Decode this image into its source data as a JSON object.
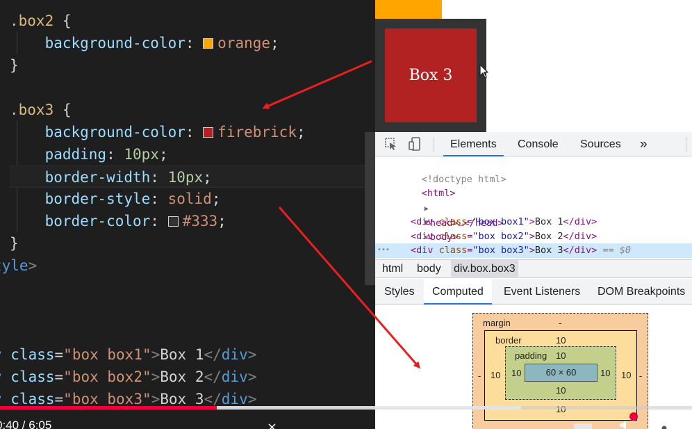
{
  "editor": {
    "lines": [
      {
        "tokens": [
          [
            "c-sel",
            ".box2"
          ],
          [
            "c-punc",
            " {"
          ]
        ]
      },
      {
        "tokens": [
          [
            "c-prop",
            "    background-color"
          ],
          [
            "c-punc",
            ": "
          ],
          [
            "swatch:#ffa500",
            ""
          ],
          [
            "c-val",
            "orange"
          ],
          [
            "c-punc",
            ";"
          ]
        ]
      },
      {
        "tokens": [
          [
            "c-punc",
            "}"
          ]
        ]
      },
      {
        "tokens": []
      },
      {
        "tokens": [
          [
            "c-sel",
            ".box3"
          ],
          [
            "c-punc",
            " {"
          ]
        ]
      },
      {
        "tokens": [
          [
            "c-prop",
            "    background-color"
          ],
          [
            "c-punc",
            ": "
          ],
          [
            "swatch:#b22222",
            ""
          ],
          [
            "c-val",
            "firebrick"
          ],
          [
            "c-punc",
            ";"
          ]
        ]
      },
      {
        "tokens": [
          [
            "c-prop",
            "    padding"
          ],
          [
            "c-punc",
            ": "
          ],
          [
            "c-num",
            "10px"
          ],
          [
            "c-punc",
            ";"
          ]
        ]
      },
      {
        "tokens": [
          [
            "c-prop",
            "    border-width"
          ],
          [
            "c-punc",
            ": "
          ],
          [
            "c-num",
            "10px"
          ],
          [
            "c-punc",
            ";"
          ]
        ]
      },
      {
        "tokens": [
          [
            "c-prop",
            "    border-style"
          ],
          [
            "c-punc",
            ": "
          ],
          [
            "c-val",
            "solid"
          ],
          [
            "c-punc",
            ";"
          ]
        ]
      },
      {
        "tokens": [
          [
            "c-prop",
            "    border-color"
          ],
          [
            "c-punc",
            ": "
          ],
          [
            "swatch:#333333",
            ""
          ],
          [
            "c-val",
            "#333"
          ],
          [
            "c-punc",
            ";"
          ]
        ]
      },
      {
        "tokens": [
          [
            "c-punc",
            "}"
          ]
        ]
      },
      {
        "tokens": [
          [
            "c-tag",
            "tyle"
          ],
          [
            "c-ang",
            ">"
          ]
        ]
      },
      {
        "tokens": []
      },
      {
        "tokens": []
      },
      {
        "tokens": []
      },
      {
        "tokens": [
          [
            "c-tag",
            "v "
          ],
          [
            "c-attr",
            "class"
          ],
          [
            "c-punc",
            "="
          ],
          [
            "c-val",
            "\"box box1\""
          ],
          [
            "c-ang",
            ">"
          ],
          [
            "c-punc",
            "Box 1"
          ],
          [
            "c-ang",
            "</"
          ],
          [
            "c-tag",
            "div"
          ],
          [
            "c-ang",
            ">"
          ]
        ]
      },
      {
        "tokens": [
          [
            "c-tag",
            "v "
          ],
          [
            "c-attr",
            "class"
          ],
          [
            "c-punc",
            "="
          ],
          [
            "c-val",
            "\"box box2\""
          ],
          [
            "c-ang",
            ">"
          ],
          [
            "c-punc",
            "Box 2"
          ],
          [
            "c-ang",
            "</"
          ],
          [
            "c-tag",
            "div"
          ],
          [
            "c-ang",
            ">"
          ]
        ]
      },
      {
        "tokens": [
          [
            "c-tag",
            "v "
          ],
          [
            "c-attr",
            "class"
          ],
          [
            "c-punc",
            "="
          ],
          [
            "c-val",
            "\"box box3\""
          ],
          [
            "c-ang",
            ">"
          ],
          [
            "c-punc",
            "Box 3"
          ],
          [
            "c-ang",
            "</"
          ],
          [
            "c-tag",
            "div"
          ],
          [
            "c-ang",
            ">"
          ]
        ]
      }
    ]
  },
  "viewport": {
    "box3_label": "Box 3",
    "colors": {
      "orange": "#ffa500",
      "firebrick": "#b22222",
      "border": "#333333"
    }
  },
  "devtools": {
    "tabs": {
      "elements": "Elements",
      "console": "Console",
      "sources": "Sources",
      "more": "»"
    },
    "dom": {
      "doctype": "<!doctype html>",
      "html_open": "<html>",
      "head": "<head>…</head>",
      "body_open": "<body>",
      "rows": [
        {
          "cls": "\"box box1\"",
          "text": "Box 1"
        },
        {
          "cls": "\"box box2\"",
          "text": "Box 2"
        },
        {
          "cls": "\"box box3\"",
          "text": "Box 3",
          "suffix": " == $0"
        }
      ],
      "ellipsis": "•••"
    },
    "breadcrumbs": [
      "html",
      "body",
      "div.box.box3"
    ],
    "style_tabs": {
      "styles": "Styles",
      "computed": "Computed",
      "listeners": "Event Listeners",
      "dom_breakpoints": "DOM Breakpoints"
    },
    "box_model": {
      "margin_label": "margin",
      "margin_top": "-",
      "margin_left": "-",
      "margin_right": "-",
      "border_label": "border",
      "border_top": "10",
      "border_left": "10",
      "border_right": "10",
      "border_bottom": "10",
      "padding_label": "padding",
      "padding_top": "10",
      "padding_left": "10",
      "padding_right": "10",
      "padding_bottom": "10",
      "content": "60 × 60"
    }
  },
  "video": {
    "time": "0:40 / 6:05",
    "played_fraction": 0.313,
    "buffered_fraction": 0.753,
    "close_icon": "×"
  }
}
